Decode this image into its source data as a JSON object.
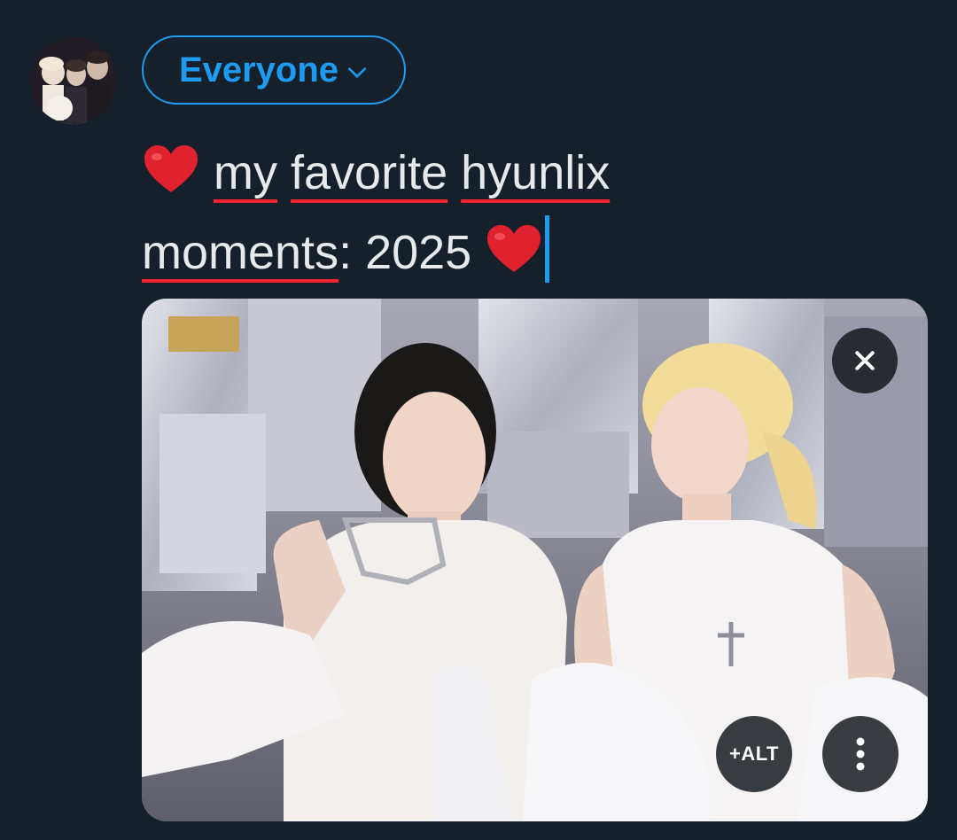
{
  "composer": {
    "audience_label": "Everyone",
    "text": {
      "line1_words": [
        "my",
        "favorite",
        "hyunlix"
      ],
      "line2_word": "moments",
      "line2_rest": ": 2025"
    },
    "media": {
      "alt_button_label": "+ALT"
    }
  },
  "icons": {
    "audience_chevron": "chevron-down-icon",
    "heart": "red-heart-emoji",
    "close": "close-icon",
    "more": "more-vertical-icon"
  },
  "colors": {
    "background": "#15202b",
    "accent": "#1d9bf0",
    "text": "#e7e9ea",
    "spellcheck_underline": "#f4212e",
    "heart": "#e0212e"
  }
}
